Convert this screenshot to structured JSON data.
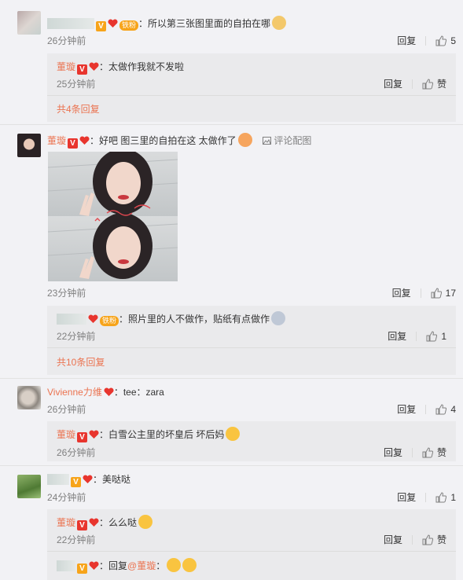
{
  "comments": [
    {
      "text": "：所以第三张图里面的自拍在哪",
      "time": "26分钟前",
      "reply": "回复",
      "likes": "5",
      "fan": "铁粉",
      "replies": [
        {
          "name": "董璇",
          "text": "：太做作我就不发啦",
          "time": "25分钟前",
          "reply": "回复",
          "like": "赞"
        }
      ],
      "more": "共4条回复"
    },
    {
      "name": "董璇",
      "text": "：好吧 图三里的自拍在这 太做作了",
      "pic_link": "评论配图",
      "time": "23分钟前",
      "reply": "回复",
      "likes": "17",
      "replies": [
        {
          "text": "：照片里的人不做作，贴纸有点做作",
          "fan": "铁粉",
          "time": "22分钟前",
          "reply": "回复",
          "likes": "1"
        }
      ],
      "more": "共10条回复"
    },
    {
      "name": "Vivienne力维",
      "text": "：tee：zara",
      "time": "26分钟前",
      "reply": "回复",
      "likes": "4",
      "replies": [
        {
          "name": "董璇",
          "text": "：白雪公主里的坏皇后 坏后妈",
          "time": "26分钟前",
          "reply": "回复",
          "like": "赞"
        }
      ]
    },
    {
      "text": "：美哒哒",
      "time": "24分钟前",
      "reply": "回复",
      "likes": "1",
      "replies": [
        {
          "name": "董璇",
          "text": "：么么哒",
          "time": "22分钟前",
          "reply": "回复",
          "like": "赞"
        },
        {
          "text": "：回复",
          "mention": "@董璇",
          "mention_tail": "："
        }
      ]
    }
  ],
  "colors": {
    "accent": "#eb7350",
    "badge": "#f7a41a",
    "heart": "#e8352e"
  }
}
